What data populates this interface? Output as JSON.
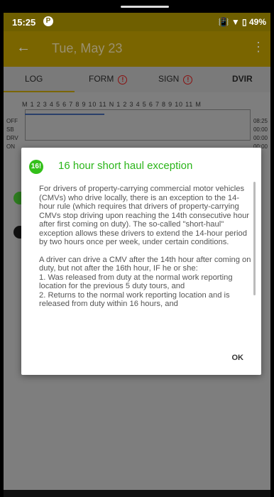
{
  "status_bar": {
    "time": "15:25",
    "app_icon": "P",
    "right_text": "📳 ▼ ▯ 49%"
  },
  "app_bar": {
    "title": "Tue, May 23",
    "back_icon": "arrow-left-icon",
    "menu_icon": "more-vert-icon"
  },
  "tabs": [
    {
      "label": "LOG"
    },
    {
      "label": "FORM"
    },
    {
      "label": "SIGN"
    },
    {
      "label": "DVIR"
    }
  ],
  "log_grid": {
    "hours_header": "M 1 2 3 4 5 6 7 8 9 10 11 N 1 2 3 4 5 6 7 8 9 10 11 M",
    "rows": [
      {
        "label": "OFF",
        "value": "08:25"
      },
      {
        "label": "SB",
        "value": "00:00"
      },
      {
        "label": "DRV",
        "value": "00:00"
      },
      {
        "label": "ON",
        "value": "00:00"
      }
    ]
  },
  "dialog": {
    "badge": "16!",
    "title": "16 hour short haul exception",
    "paragraph1": "For drivers of property-carrying commercial motor vehicles (CMVs) who drive locally, there is an exception to the 14-hour rule (which requires that drivers of property-carrying CMVs stop driving upon reaching the 14th consecutive hour after first coming on duty). The so-called \"short-haul\" exception allows these drivers to extend the 14-hour period by two hours once per week, under certain conditions.",
    "paragraph2": "A driver can drive a CMV after the 14th hour after coming on duty, but not after the 16th hour, IF he or she:",
    "item1": "1. Was released from duty at the normal work reporting location for the previous 5 duty tours, and",
    "item2": "2. Returns to the normal work reporting location and is released from duty within 16 hours, and",
    "ok_label": "OK"
  },
  "colors": {
    "accent_green": "#2bb51a",
    "app_bar": "#7a6500"
  }
}
